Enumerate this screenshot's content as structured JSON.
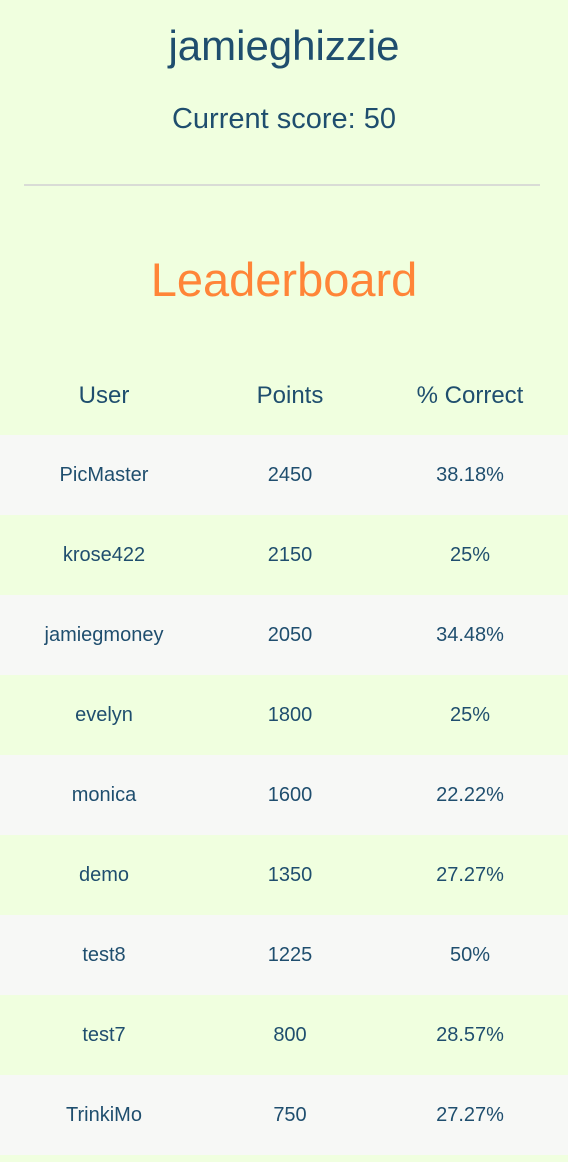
{
  "profile": {
    "username": "jamieghizzie",
    "score_text": "Current score: 50"
  },
  "leaderboard": {
    "title": "Leaderboard",
    "columns": [
      "User",
      "Points",
      "% Correct"
    ],
    "rows": [
      {
        "user": "PicMaster",
        "points": "2450",
        "correct": "38.18%"
      },
      {
        "user": "krose422",
        "points": "2150",
        "correct": "25%"
      },
      {
        "user": "jamiegmoney",
        "points": "2050",
        "correct": "34.48%"
      },
      {
        "user": "evelyn",
        "points": "1800",
        "correct": "25%"
      },
      {
        "user": "monica",
        "points": "1600",
        "correct": "22.22%"
      },
      {
        "user": "demo",
        "points": "1350",
        "correct": "27.27%"
      },
      {
        "user": "test8",
        "points": "1225",
        "correct": "50%"
      },
      {
        "user": "test7",
        "points": "800",
        "correct": "28.57%"
      },
      {
        "user": "TrinkiMo",
        "points": "750",
        "correct": "27.27%"
      }
    ]
  },
  "colors": {
    "background": "#f0ffdf",
    "alt_row": "#f7f8f6",
    "text": "#1f4e6e",
    "accent": "#ff8538"
  }
}
